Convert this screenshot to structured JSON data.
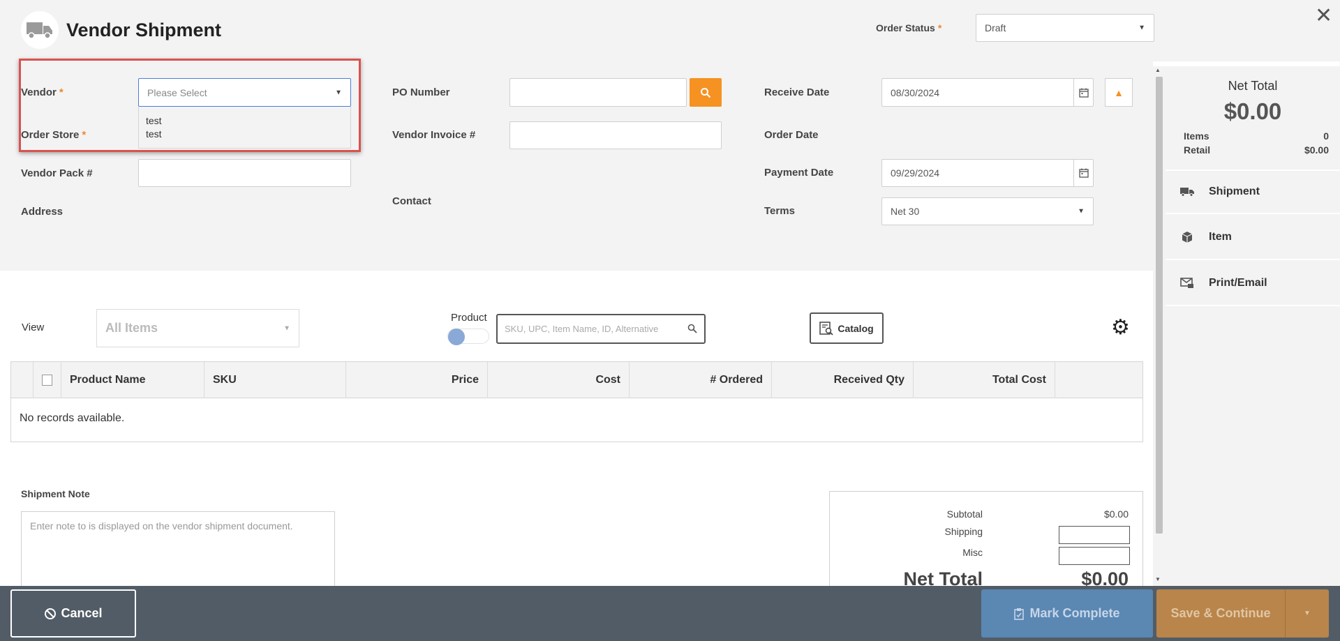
{
  "header": {
    "title": "Vendor Shipment",
    "order_status_label": "Order Status",
    "order_status_value": "Draft"
  },
  "form": {
    "vendor_label": "Vendor",
    "vendor_placeholder": "Please Select",
    "vendor_options": [
      "test",
      "test"
    ],
    "order_store_label": "Order Store",
    "vendor_pack_label": "Vendor Pack #",
    "address_label": "Address",
    "po_number_label": "PO Number",
    "vendor_invoice_label": "Vendor Invoice #",
    "contact_label": "Contact",
    "receive_date_label": "Receive Date",
    "receive_date_value": "08/30/2024",
    "order_date_label": "Order Date",
    "payment_date_label": "Payment Date",
    "payment_date_value": "09/29/2024",
    "terms_label": "Terms",
    "terms_value": "Net 30",
    "required_mark": "*"
  },
  "sidebar": {
    "net_total_label": "Net Total",
    "net_total_value": "$0.00",
    "items_label": "Items",
    "items_value": "0",
    "retail_label": "Retail",
    "retail_value": "$0.00",
    "nav": [
      {
        "label": "Shipment",
        "icon": "truck-icon"
      },
      {
        "label": "Item",
        "icon": "box-icon"
      },
      {
        "label": "Print/Email",
        "icon": "print-email-icon"
      }
    ]
  },
  "toolbar": {
    "view_label": "View",
    "view_value": "All Items",
    "product_label": "Product",
    "search_placeholder": "SKU, UPC, Item Name, ID, Alternative",
    "catalog_label": "Catalog"
  },
  "table": {
    "columns": [
      "Product Name",
      "SKU",
      "Price",
      "Cost",
      "# Ordered",
      "Received Qty",
      "Total Cost"
    ],
    "empty_text": "No records available."
  },
  "note": {
    "label": "Shipment Note",
    "placeholder": "Enter note to is displayed on the vendor shipment document."
  },
  "totals": {
    "subtotal_label": "Subtotal",
    "subtotal_value": "$0.00",
    "shipping_label": "Shipping",
    "misc_label": "Misc",
    "net_total_label": "Net Total",
    "net_total_value": "$0.00"
  },
  "footer": {
    "cancel_label": "Cancel",
    "mark_complete_label": "Mark Complete",
    "save_continue_label": "Save & Continue"
  },
  "colors": {
    "accent_orange": "#f59222",
    "highlight_red": "#d9534f",
    "footer_bg": "#525c66",
    "mark_complete_bg": "#5b87b3",
    "save_bg": "#b9854a"
  }
}
